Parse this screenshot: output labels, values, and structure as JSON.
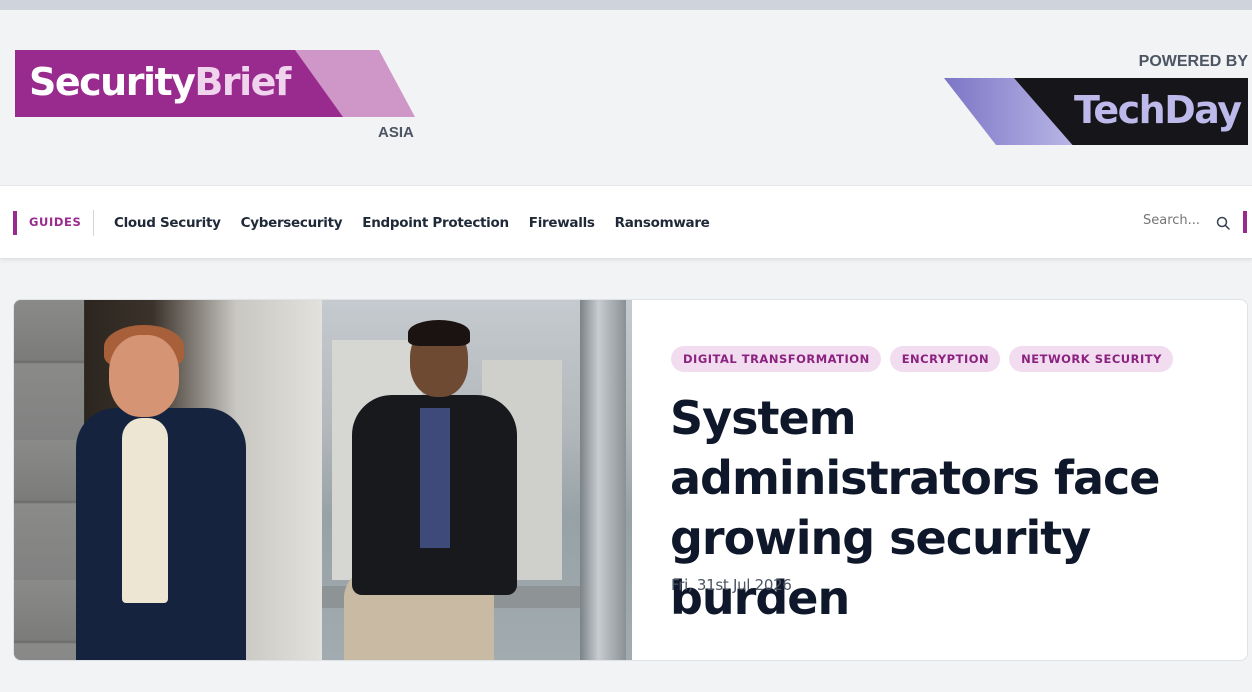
{
  "header": {
    "brand_part1": "Security",
    "brand_part2": "Brief",
    "region": "ASIA",
    "powered_by": "POWERED BY",
    "partner_logo": "TechDay"
  },
  "nav": {
    "guides_label": "GUIDES",
    "links": [
      "Cloud Security",
      "Cybersecurity",
      "Endpoint Protection",
      "Firewalls",
      "Ransomware"
    ],
    "search_placeholder": "Search..."
  },
  "feature": {
    "tags": [
      "DIGITAL TRANSFORMATION",
      "ENCRYPTION",
      "NETWORK SECURITY"
    ],
    "headline": "System administrators face growing security burden",
    "date": "Fri, 31st Jul 2026"
  },
  "colors": {
    "brand": "#9a2b8e",
    "brand_light": "#cf97c7",
    "tag_bg": "#f1ddef",
    "headline": "#0f172a"
  },
  "icons": {
    "search": "search-icon"
  }
}
